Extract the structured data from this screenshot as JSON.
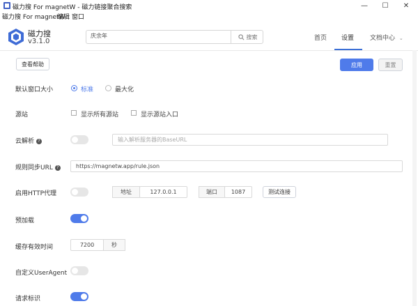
{
  "window": {
    "title": "磁力搜 For magnetW - 磁力链接聚合搜索",
    "minimize_glyph": "—",
    "maximize_glyph": "☐",
    "close_glyph": "✕"
  },
  "menu": {
    "items": [
      "磁力搜 For magnetW",
      "编辑",
      "窗口"
    ]
  },
  "header": {
    "brand": "磁力搜",
    "version": "v3.1.0",
    "search": {
      "value": "庆余年",
      "button_label": "搜索",
      "icon": "search-icon"
    },
    "nav": [
      {
        "label": "首页",
        "active": false
      },
      {
        "label": "设置",
        "active": true
      },
      {
        "label": "文档中心",
        "active": false,
        "has_dropdown": true
      }
    ]
  },
  "toolbar": {
    "help_label": "查看帮助",
    "apply_label": "应用",
    "reset_label": "重置"
  },
  "settings": {
    "window_size": {
      "label": "默认窗口大小",
      "options": [
        "标准",
        "最大化"
      ],
      "selected": "标准"
    },
    "source": {
      "label": "源站",
      "options": [
        "显示所有源站",
        "显示源站入口"
      ]
    },
    "cloud_parse": {
      "label": "云解析",
      "enabled": false,
      "placeholder": "输入解析服务器的BaseURL"
    },
    "rule_sync": {
      "label": "规则同步URL",
      "value": "https://magnetw.app/rule.json"
    },
    "http_proxy": {
      "label": "启用HTTP代理",
      "enabled": false,
      "address_label": "地址",
      "address": "127.0.0.1",
      "port_label": "端口",
      "port": "1087",
      "test_label": "测试连接"
    },
    "preload": {
      "label": "预加载",
      "enabled": true
    },
    "cache_ttl": {
      "label": "缓存有效时间",
      "value": "7200",
      "unit": "秒"
    },
    "user_agent": {
      "label": "自定义UserAgent",
      "enabled": false
    },
    "request_id": {
      "label": "请求标识",
      "enabled": true
    }
  },
  "colors": {
    "accent": "#4f7bea",
    "toggle_off": "#e6e6e6"
  }
}
